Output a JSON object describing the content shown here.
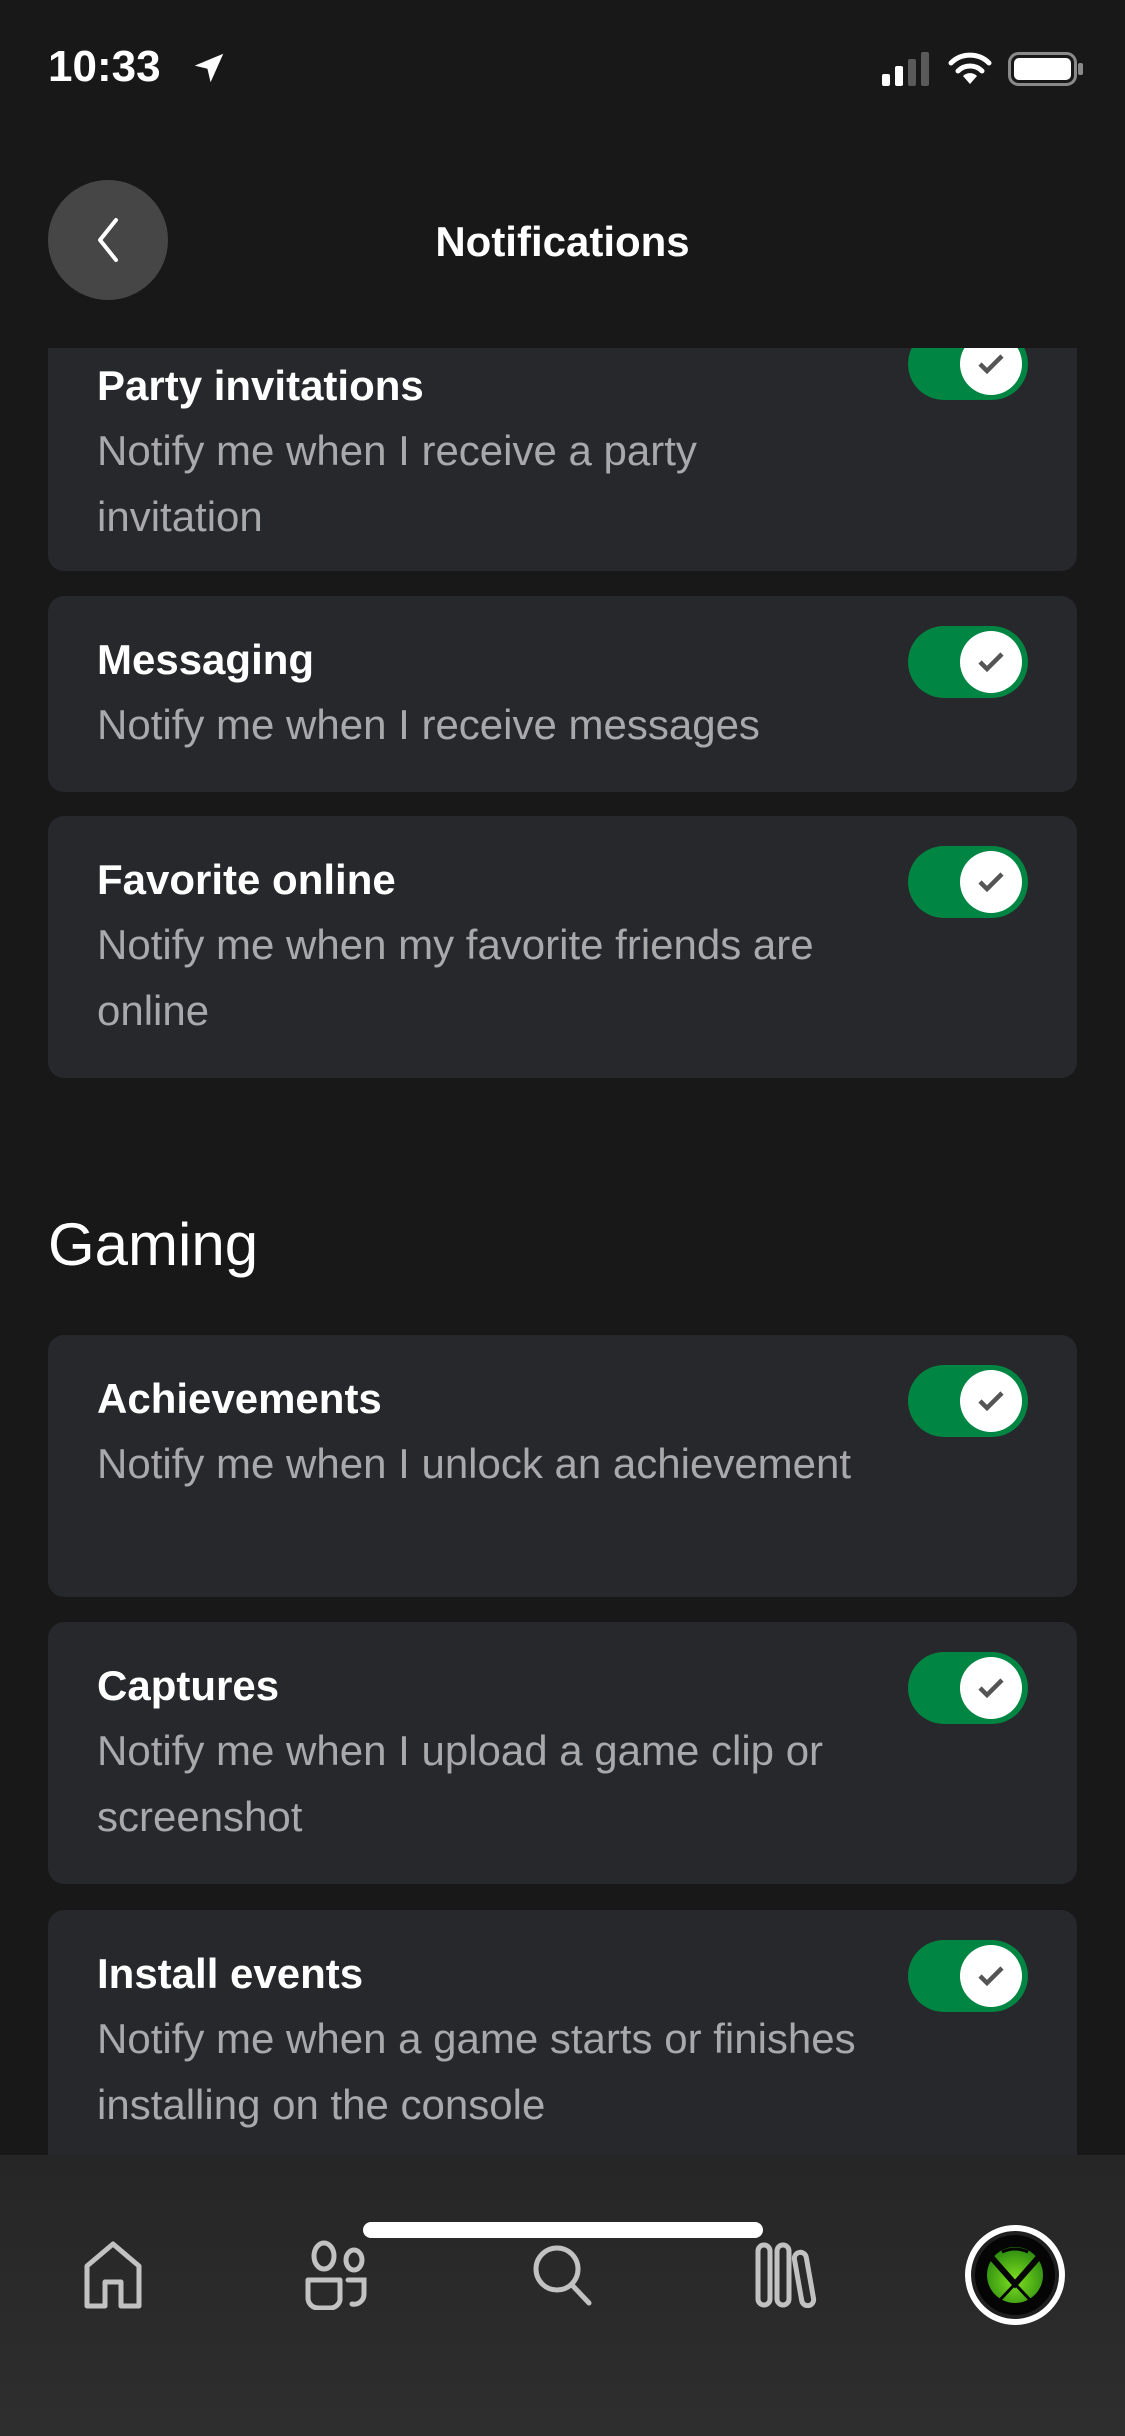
{
  "status_bar": {
    "time": "10:33",
    "location_icon": "location-arrow-icon",
    "signal_icon": "cellular-signal-icon",
    "wifi_icon": "wifi-icon",
    "battery_icon": "battery-icon"
  },
  "header": {
    "title": "Notifications",
    "back_icon": "chevron-left-icon"
  },
  "colors": {
    "background": "#181819",
    "card": "#27282c",
    "toggle_on": "#008542",
    "description": "#a9a9ab"
  },
  "sections": [
    {
      "heading": "",
      "items": [
        {
          "title": "Party invitations",
          "description": "Notify me when I receive a party invitation",
          "enabled": true
        },
        {
          "title": "Messaging",
          "description": "Notify me when I receive messages",
          "enabled": true
        },
        {
          "title": "Favorite online",
          "description": "Notify me when my favorite friends are online",
          "enabled": true
        }
      ]
    },
    {
      "heading": "Gaming",
      "items": [
        {
          "title": "Achievements",
          "description": "Notify me when I unlock an achievement",
          "enabled": true
        },
        {
          "title": "Captures",
          "description": "Notify me when I upload a game clip or screenshot",
          "enabled": true
        },
        {
          "title": "Install events",
          "description": "Notify me when a game starts or finishes installing on the console",
          "enabled": true
        }
      ]
    }
  ],
  "bottom_nav": {
    "items": [
      {
        "name": "home",
        "icon": "home-icon"
      },
      {
        "name": "social",
        "icon": "people-icon"
      },
      {
        "name": "search",
        "icon": "search-icon"
      },
      {
        "name": "library",
        "icon": "library-icon"
      },
      {
        "name": "profile",
        "icon": "xbox-avatar-icon",
        "active": true
      }
    ]
  }
}
